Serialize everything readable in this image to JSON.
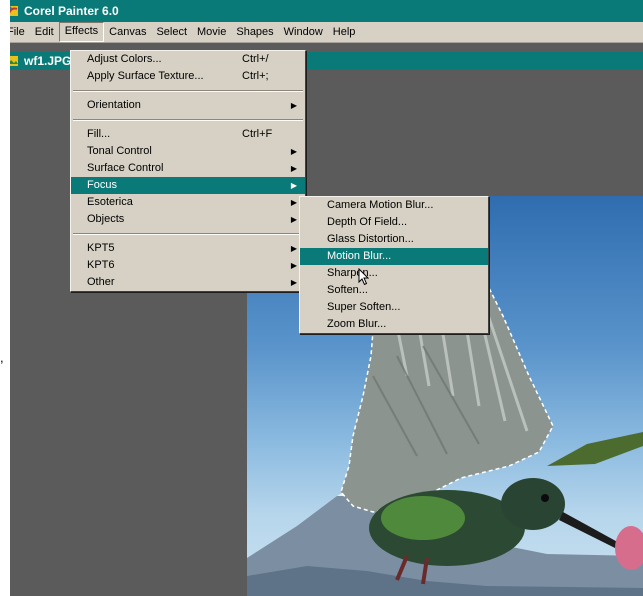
{
  "app": {
    "title": "Corel Painter 6.0"
  },
  "menubar": {
    "items": [
      "File",
      "Edit",
      "Effects",
      "Canvas",
      "Select",
      "Movie",
      "Shapes",
      "Window",
      "Help"
    ]
  },
  "document": {
    "title": "wf1.JPG"
  },
  "effects_menu": {
    "items": [
      {
        "label": "Adjust Colors...",
        "shortcut": "Ctrl+/"
      },
      {
        "label": "Apply Surface Texture...",
        "shortcut": "Ctrl+;"
      },
      {
        "label": "Orientation",
        "submenu": true
      },
      {
        "label": "Fill...",
        "shortcut": "Ctrl+F"
      },
      {
        "label": "Tonal Control",
        "submenu": true
      },
      {
        "label": "Surface Control",
        "submenu": true
      },
      {
        "label": "Focus",
        "submenu": true
      },
      {
        "label": "Esoterica",
        "submenu": true
      },
      {
        "label": "Objects",
        "submenu": true
      },
      {
        "label": "KPT5",
        "submenu": true
      },
      {
        "label": "KPT6",
        "submenu": true
      },
      {
        "label": "Other",
        "submenu": true
      }
    ],
    "arrow": "▶"
  },
  "focus_menu": {
    "items": [
      "Camera Motion Blur...",
      "Depth Of Field...",
      "Glass Distortion...",
      "Motion Blur...",
      "Sharpen...",
      "Soften...",
      "Super Soften...",
      "Zoom Blur..."
    ]
  },
  "page": {
    "stray_mark": ","
  },
  "colors": {
    "titlebar": "#0a7a78",
    "highlight": "#0a7a78",
    "menu_bg": "#d6d1c4",
    "workspace": "#5b5b5b"
  },
  "icons": {
    "app": "corel-painter-icon",
    "document": "image-document-icon",
    "cursor": "mouse-pointer-icon"
  }
}
